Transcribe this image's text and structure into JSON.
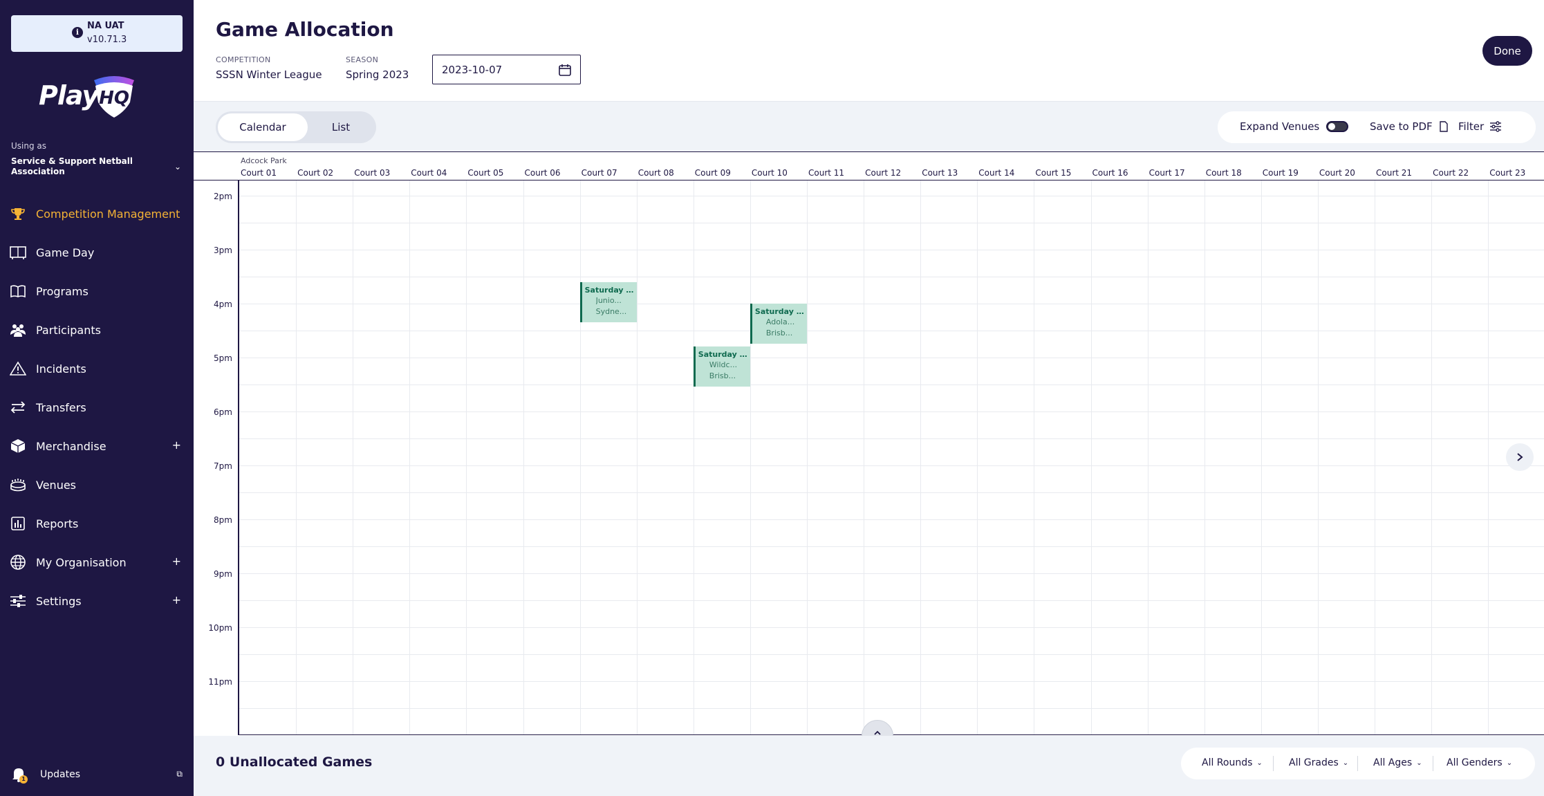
{
  "env": {
    "name": "NA UAT",
    "version": "v10.71.3"
  },
  "logo": {
    "text": "Play",
    "mark": "HQ"
  },
  "sidebar": {
    "using_as_label": "Using as",
    "org_name": "Service & Support Netball Association",
    "items": [
      {
        "label": "Competition Management",
        "icon": "trophy-icon",
        "active": true,
        "expandable": false
      },
      {
        "label": "Game Day",
        "icon": "scoreboard-icon",
        "active": false,
        "expandable": false
      },
      {
        "label": "Programs",
        "icon": "book-icon",
        "active": false,
        "expandable": false
      },
      {
        "label": "Participants",
        "icon": "people-icon",
        "active": false,
        "expandable": false
      },
      {
        "label": "Incidents",
        "icon": "warning-icon",
        "active": false,
        "expandable": false
      },
      {
        "label": "Transfers",
        "icon": "transfer-icon",
        "active": false,
        "expandable": false
      },
      {
        "label": "Merchandise",
        "icon": "box-icon",
        "active": false,
        "expandable": true
      },
      {
        "label": "Venues",
        "icon": "stadium-icon",
        "active": false,
        "expandable": false
      },
      {
        "label": "Reports",
        "icon": "report-icon",
        "active": false,
        "expandable": false
      },
      {
        "label": "My Organisation",
        "icon": "globe-icon",
        "active": false,
        "expandable": true
      },
      {
        "label": "Settings",
        "icon": "sliders-icon",
        "active": false,
        "expandable": true
      }
    ],
    "updates_label": "Updates",
    "updates_badge": "1"
  },
  "header": {
    "title": "Game Allocation",
    "competition_label": "COMPETITION",
    "competition_value": "SSSN Winter League",
    "season_label": "SEASON",
    "season_value": "Spring 2023",
    "date_value": "2023-10-07",
    "done_label": "Done"
  },
  "toolbar": {
    "views": [
      "Calendar",
      "List"
    ],
    "active_view": "Calendar",
    "expand_venues_label": "Expand Venues",
    "expand_venues_on": false,
    "save_pdf_label": "Save to PDF",
    "filter_label": "Filter"
  },
  "calendar": {
    "venue": "Adcock Park",
    "courts": [
      "Court 01",
      "Court 02",
      "Court 03",
      "Court 04",
      "Court 05",
      "Court 06",
      "Court 07",
      "Court 08",
      "Court 09",
      "Court 10",
      "Court 11",
      "Court 12",
      "Court 13",
      "Court 14",
      "Court 15",
      "Court 16",
      "Court 17",
      "Court 18",
      "Court 19",
      "Court 20",
      "Court 21",
      "Court 22",
      "Court 23"
    ],
    "times": [
      "2pm",
      "3pm",
      "4pm",
      "5pm",
      "6pm",
      "7pm",
      "8pm",
      "9pm",
      "10pm",
      "11pm"
    ],
    "events": [
      {
        "court_index": 6,
        "start_hour": 15.6,
        "title": "Saturday J...",
        "teams": [
          "Junio...",
          "Sydne..."
        ]
      },
      {
        "court_index": 9,
        "start_hour": 16.0,
        "title": "Saturday J...",
        "teams": [
          "Adola...",
          "Brisb..."
        ]
      },
      {
        "court_index": 8,
        "start_hour": 16.8,
        "title": "Saturday J...",
        "teams": [
          "Wildc...",
          "Brisb..."
        ]
      }
    ]
  },
  "footer": {
    "unallocated_label": "0 Unallocated Games",
    "filters": [
      "All Rounds",
      "All Grades",
      "All Ages",
      "All Genders"
    ]
  }
}
